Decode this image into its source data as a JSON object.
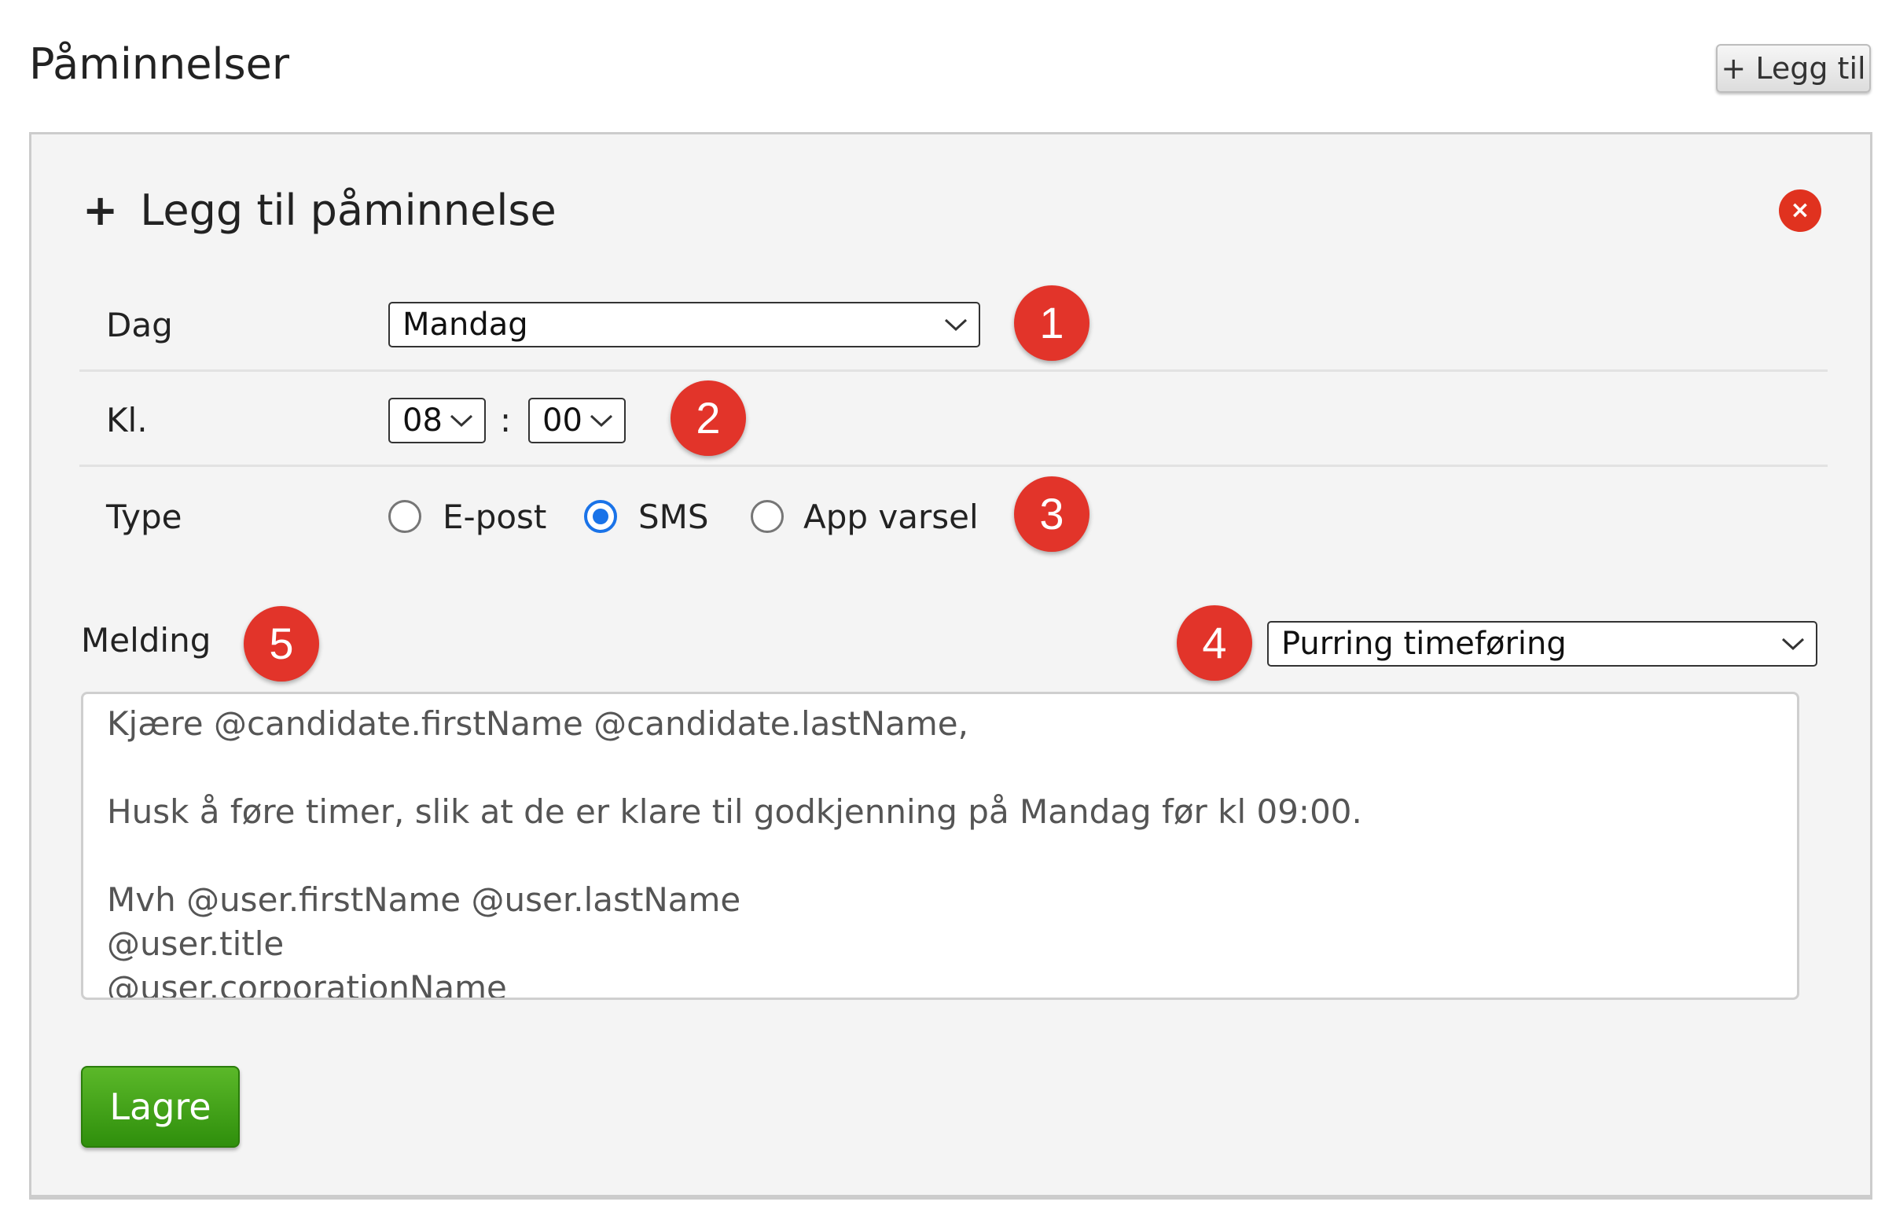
{
  "page": {
    "title": "Påminnelser",
    "add_button_label": "+ Legg til"
  },
  "panel": {
    "title": "Legg til påminnelse",
    "close_symbol": "×",
    "fields": {
      "day": {
        "label": "Dag",
        "value": "Mandag"
      },
      "time": {
        "label": "Kl.",
        "hour": "08",
        "separator": ":",
        "minute": "00"
      },
      "type": {
        "label": "Type",
        "options": [
          {
            "label": "E-post",
            "checked": false
          },
          {
            "label": "SMS",
            "checked": true
          },
          {
            "label": "App varsel",
            "checked": false
          }
        ]
      }
    },
    "message": {
      "label": "Melding",
      "template": "Purring timeføring",
      "lines": [
        "Kjære @candidate.firstName @candidate.lastName,",
        "",
        "Husk å føre timer, slik at de er klare til godkjenning på Mandag før kl 09:00.",
        "",
        "Mvh @user.firstName @user.lastName",
        "@user.title",
        "@user.corporationName"
      ]
    },
    "save_label": "Lagre"
  },
  "callouts": [
    "1",
    "2",
    "3",
    "4",
    "5"
  ],
  "colors": {
    "badge": "#e2342a",
    "save": "#3a9a12",
    "radio_checked": "#1a73e8",
    "close": "#e0321f"
  }
}
